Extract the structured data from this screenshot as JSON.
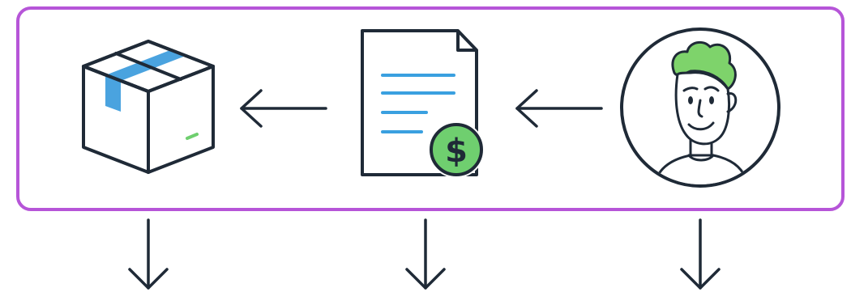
{
  "colors": {
    "frame": "#b655d8",
    "ink": "#1f2a37",
    "tape": "#4aa3df",
    "lines": "#3aa0e0",
    "coin": "#6fcf6f",
    "hair": "#7ed36b",
    "background": "#ffffff"
  },
  "flow": [
    "customer",
    "invoice",
    "package"
  ],
  "symbols": {
    "currency": "$"
  },
  "icons": {
    "package": "package-box-icon",
    "invoice": "invoice-document-icon",
    "customer": "customer-avatar-icon",
    "arrow_left": "arrow-left-icon",
    "arrow_down": "arrow-down-icon"
  }
}
